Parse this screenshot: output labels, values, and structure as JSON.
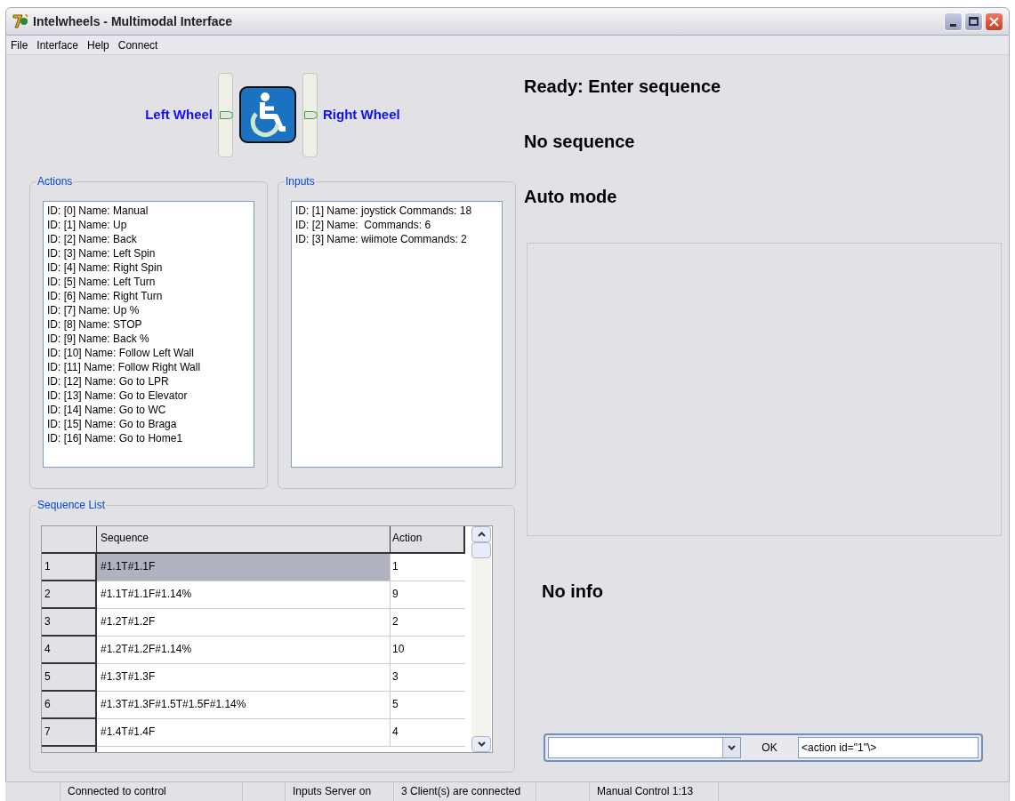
{
  "window": {
    "title": "Intelwheels - Multimodal Interface"
  },
  "menu": [
    "File",
    "Interface",
    "Help",
    "Connect"
  ],
  "wheels": [
    {
      "label": "Left Wheel",
      "level": 0.5
    },
    {
      "label": "Right Wheel",
      "level": 0.5
    }
  ],
  "actions": {
    "title": "Actions",
    "items": [
      "ID: [0] Name: Manual",
      "ID: [1] Name: Up",
      "ID: [2] Name: Back",
      "ID: [3] Name: Left Spin",
      "ID: [4] Name: Right Spin",
      "ID: [5] Name: Left Turn",
      "ID: [6] Name: Right Turn",
      "ID: [7] Name: Up %",
      "ID: [8] Name: STOP",
      "ID: [9] Name: Back %",
      "ID: [10] Name: Follow Left Wall",
      "ID: [11] Name: Follow Right Wall",
      "ID: [12] Name: Go to LPR",
      "ID: [13] Name: Go to Elevator",
      "ID: [14] Name: Go to WC",
      "ID: [15] Name: Go to Braga",
      "ID: [16] Name: Go to Home1"
    ]
  },
  "inputs": {
    "title": "Inputs",
    "items": [
      "ID: [1] Name: joystick Commands: 18",
      "ID: [2] Name:  Commands: 6",
      "ID: [3] Name: wiimote Commands: 2"
    ]
  },
  "sequence_list": {
    "title": "Sequence List",
    "columns": [
      "Sequence",
      "Action"
    ],
    "rows": [
      {
        "index": "1",
        "sequence": "#1.1T#1.1F",
        "action": "1",
        "selected": true
      },
      {
        "index": "2",
        "sequence": "#1.1T#1.1F#1.14%",
        "action": "9",
        "selected": false
      },
      {
        "index": "3",
        "sequence": "#1.2T#1.2F",
        "action": "2",
        "selected": false
      },
      {
        "index": "4",
        "sequence": "#1.2T#1.2F#1.14%",
        "action": "10",
        "selected": false
      },
      {
        "index": "5",
        "sequence": "#1.3T#1.3F",
        "action": "3",
        "selected": false
      },
      {
        "index": "6",
        "sequence": "#1.3T#1.3F#1.5T#1.5F#1.14%",
        "action": "5",
        "selected": false
      },
      {
        "index": "7",
        "sequence": "#1.4T#1.4F",
        "action": "4",
        "selected": false
      }
    ]
  },
  "status_lines": [
    "Ready: Enter sequence",
    "No sequence",
    "Auto mode"
  ],
  "info": "No info",
  "command_bar": {
    "ok_button": "OK",
    "command_value": "<action id=\"1\"\\>"
  },
  "status_bar": [
    {
      "kind": "blank"
    },
    {
      "kind": "text",
      "text": "Connected to control"
    },
    {
      "kind": "blank"
    },
    {
      "kind": "text",
      "text": "Inputs Server on"
    },
    {
      "kind": "text",
      "text": "3 Client(s) are connected"
    },
    {
      "kind": "blank"
    },
    {
      "kind": "text",
      "text": "Manual Control 1:13"
    },
    {
      "kind": "blank"
    }
  ]
}
